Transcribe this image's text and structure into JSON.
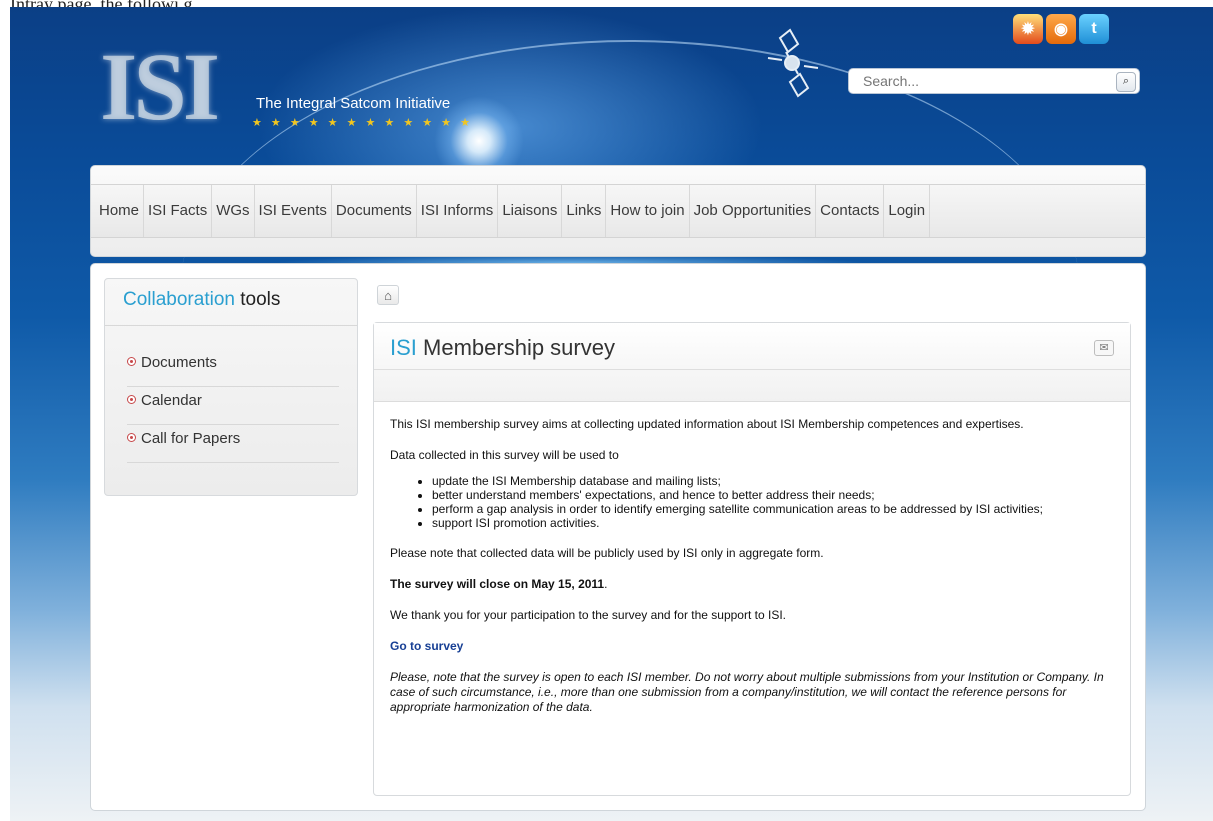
{
  "top_text": "Intray page, the followi g",
  "branding": {
    "logo_text": "ISI",
    "tagline": "The Integral Satcom Initiative",
    "stars": "★ ★ ★ ★ ★ ★ ★ ★ ★ ★ ★ ★"
  },
  "social": [
    "flame-icon",
    "rss-icon",
    "twitter-icon"
  ],
  "search": {
    "placeholder": "Search..."
  },
  "nav": [
    "Home",
    "ISI Facts",
    "WGs",
    "ISI Events",
    "Documents",
    "ISI Informs",
    "Liaisons",
    "Links",
    "How to join",
    "Job Opportunities",
    "Contacts",
    "Login"
  ],
  "sidebar": {
    "title_accent": "Collaboration",
    "title_rest": "tools",
    "items": [
      "Documents",
      "Calendar",
      "Call for Papers"
    ]
  },
  "article": {
    "title_accent": "ISI",
    "title_rest": "Membership survey",
    "intro": "This ISI membership survey aims at collecting updated information about ISI Membership competences and expertises.",
    "data_used": "Data collected in this survey will be used to",
    "bullets": [
      "update the ISI Membership database and mailing lists;",
      "better understand members' expectations, and hence to better address their needs;",
      "perform a gap analysis in order to identify emerging satellite communication areas to be addressed by ISI activities;",
      " support ISI promotion activities."
    ],
    "privacy": "Please note that collected data will be publicly used by ISI only in aggregate form.",
    "close_notice": "The survey will close on May 15, 2011",
    "close_period": ".",
    "thanks": "We thank you for your participation to the survey and for the support to ISI.",
    "link": "Go to survey",
    "note": "Please, note that the survey is open to each ISI member. Do not worry about multiple submissions from your Institution or Company. In case of such circumstance, i.e., more than one submission from a company/institution, we will contact the reference persons for appropriate harmonization of the data."
  }
}
